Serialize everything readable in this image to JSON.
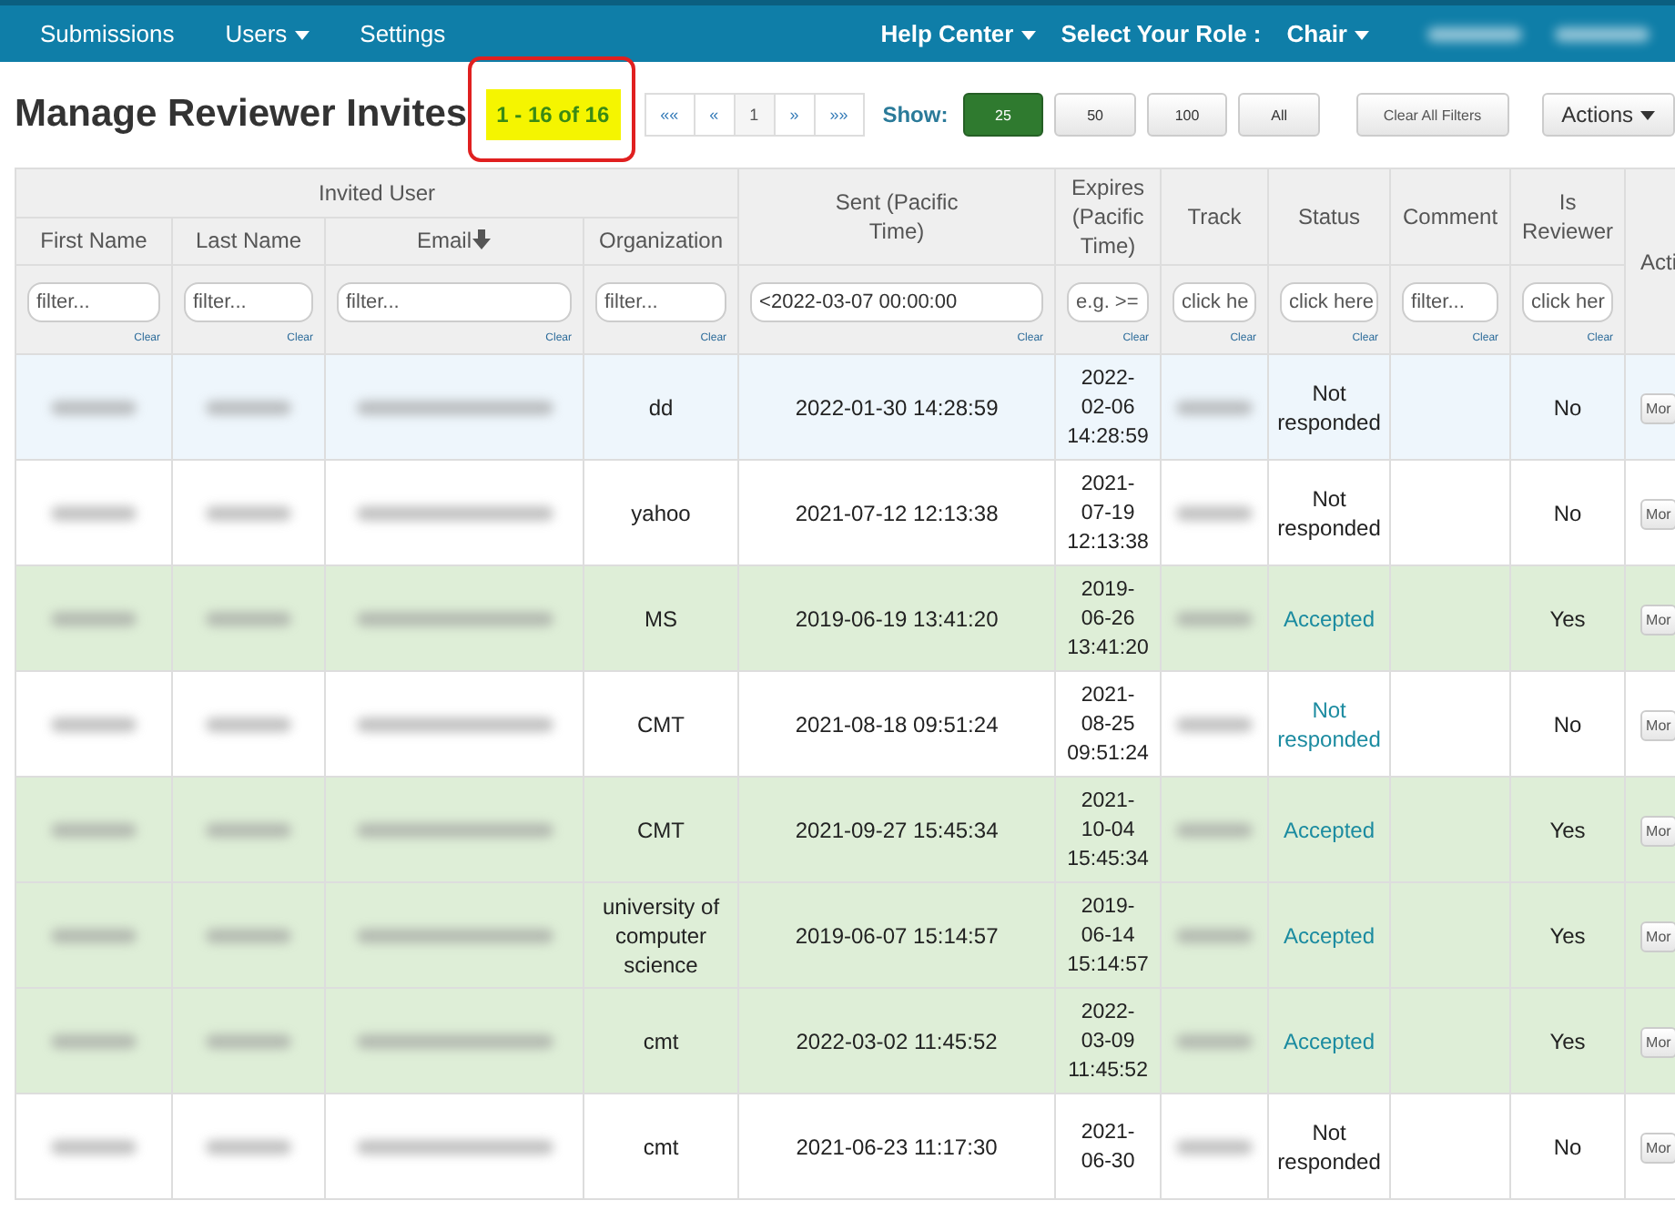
{
  "nav": {
    "left": [
      {
        "label": "Submissions",
        "dropdown": false
      },
      {
        "label": "Users",
        "dropdown": true
      },
      {
        "label": "Settings",
        "dropdown": false
      }
    ],
    "right": [
      {
        "label": "Help Center",
        "dropdown": true
      },
      {
        "label": "Select Your Role :",
        "dropdown": false
      },
      {
        "label": "Chair",
        "dropdown": true
      }
    ]
  },
  "toolbar": {
    "title": "Manage Reviewer Invites",
    "count": "1 - 16 of 16",
    "pager": [
      "««",
      "«",
      "1",
      "»",
      "»»"
    ],
    "show_label": "Show:",
    "page_sizes": [
      {
        "label": "25",
        "selected": true
      },
      {
        "label": "50",
        "selected": false
      },
      {
        "label": "100",
        "selected": false
      },
      {
        "label": "All",
        "selected": false
      }
    ],
    "clear_filters": "Clear All Filters",
    "actions": {
      "label": "Actions",
      "dropdown": true
    }
  },
  "table": {
    "group_header": "Invited User",
    "columns": [
      {
        "label": "First Name",
        "kind": "grouped",
        "sorted": false,
        "filter": {
          "placeholder": "filter...",
          "clear": "Clear"
        }
      },
      {
        "label": "Last Name",
        "kind": "grouped",
        "sorted": false,
        "filter": {
          "placeholder": "filter...",
          "clear": "Clear"
        }
      },
      {
        "label": "Email",
        "kind": "grouped",
        "sorted": true,
        "filter": {
          "placeholder": "filter...",
          "clear": "Clear"
        }
      },
      {
        "label": "Organization",
        "kind": "grouped",
        "sorted": false,
        "filter": {
          "placeholder": "filter...",
          "clear": "Clear"
        }
      },
      {
        "label": "Sent (Pacific Time)",
        "kind": "single",
        "sorted": false,
        "filter": {
          "value": "<2022-03-07 00:00:00",
          "clear": "Clear"
        }
      },
      {
        "label": "Expires (Pacific Time)",
        "kind": "single",
        "sorted": false,
        "filter": {
          "placeholder": "e.g. >=",
          "clear": "Clear"
        }
      },
      {
        "label": "Track",
        "kind": "single",
        "sorted": false,
        "filter": {
          "placeholder": "click he",
          "clear": "Clear"
        }
      },
      {
        "label": "Status",
        "kind": "single",
        "sorted": false,
        "filter": {
          "placeholder": "click here",
          "clear": "Clear"
        }
      },
      {
        "label": "Comment",
        "kind": "single",
        "sorted": false,
        "filter": {
          "placeholder": "filter...",
          "clear": "Clear"
        }
      },
      {
        "label": "Is Reviewer",
        "kind": "single",
        "sorted": false,
        "filter": {
          "placeholder": "click her",
          "clear": "Clear"
        }
      },
      {
        "label": "Acti",
        "kind": "action"
      }
    ],
    "rows": [
      {
        "hovered": true,
        "accepted": false,
        "organization": "dd",
        "sent": "2022-01-30 14:28:59",
        "expires": "2022-02-06 14:28:59",
        "status": "Not responded",
        "status_link": false,
        "is_reviewer": "No",
        "action": "Mor"
      },
      {
        "hovered": false,
        "accepted": false,
        "organization": "yahoo",
        "sent": "2021-07-12 12:13:38",
        "expires": "2021-07-19 12:13:38",
        "status": "Not responded",
        "status_link": false,
        "is_reviewer": "No",
        "action": "Mor"
      },
      {
        "hovered": false,
        "accepted": true,
        "organization": "MS",
        "sent": "2019-06-19 13:41:20",
        "expires": "2019-06-26 13:41:20",
        "status": "Accepted",
        "status_link": true,
        "is_reviewer": "Yes",
        "action": "Mor"
      },
      {
        "hovered": false,
        "accepted": false,
        "organization": "CMT",
        "sent": "2021-08-18 09:51:24",
        "expires": "2021-08-25 09:51:24",
        "status": "Not responded",
        "status_link": true,
        "is_reviewer": "No",
        "action": "Mor"
      },
      {
        "hovered": false,
        "accepted": true,
        "organization": "CMT",
        "sent": "2021-09-27 15:45:34",
        "expires": "2021-10-04 15:45:34",
        "status": "Accepted",
        "status_link": true,
        "is_reviewer": "Yes",
        "action": "Mor"
      },
      {
        "hovered": false,
        "accepted": true,
        "organization": "university of computer science",
        "sent": "2019-06-07 15:14:57",
        "expires": "2019-06-14 15:14:57",
        "status": "Accepted",
        "status_link": true,
        "is_reviewer": "Yes",
        "action": "Mor"
      },
      {
        "hovered": false,
        "accepted": true,
        "organization": "cmt",
        "sent": "2022-03-02 11:45:52",
        "expires": "2022-03-09 11:45:52",
        "status": "Accepted",
        "status_link": true,
        "is_reviewer": "Yes",
        "action": "Mor"
      },
      {
        "hovered": false,
        "accepted": false,
        "organization": "cmt",
        "sent": "2021-06-23 11:17:30",
        "expires": "2021-06-30",
        "status": "Not responded",
        "status_link": false,
        "is_reviewer": "No",
        "action": "Mor"
      }
    ]
  }
}
